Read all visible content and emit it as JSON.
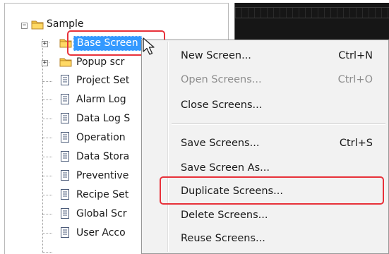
{
  "tree": {
    "root": "Sample",
    "items": [
      {
        "label": "Base Screen",
        "kind": "folder",
        "expandable": true
      },
      {
        "label": "Popup scr",
        "kind": "folder",
        "expandable": true
      },
      {
        "label": "Project Set",
        "kind": "doc"
      },
      {
        "label": "Alarm Log",
        "kind": "doc"
      },
      {
        "label": "Data Log S",
        "kind": "doc"
      },
      {
        "label": "Operation",
        "kind": "doc"
      },
      {
        "label": "Data Stora",
        "kind": "doc"
      },
      {
        "label": "Preventive",
        "kind": "doc"
      },
      {
        "label": "Recipe Set",
        "kind": "doc"
      },
      {
        "label": "Global Scr",
        "kind": "doc"
      },
      {
        "label": "User Acco",
        "kind": "doc"
      }
    ]
  },
  "context_menu": {
    "items": [
      {
        "label": "New Screen...",
        "shortcut": "Ctrl+N",
        "enabled": true
      },
      {
        "label": "Open Screens...",
        "shortcut": "Ctrl+O",
        "enabled": false
      },
      {
        "label": "Close Screens...",
        "shortcut": "",
        "enabled": true
      },
      {
        "label": "Save Screens...",
        "shortcut": "Ctrl+S",
        "enabled": true
      },
      {
        "label": "Save Screen As...",
        "shortcut": "",
        "enabled": true
      },
      {
        "label": "Duplicate Screens...",
        "shortcut": "",
        "enabled": true
      },
      {
        "label": "Delete Screens...",
        "shortcut": "",
        "enabled": true
      },
      {
        "label": "Reuse Screens...",
        "shortcut": "",
        "enabled": true
      }
    ]
  },
  "icons": {
    "folder": "folder-icon",
    "document": "document-icon",
    "expand": "expand-toggle-icon",
    "collapse": "collapse-toggle-icon",
    "cursor": "mouse-cursor-icon"
  },
  "colors": {
    "selection": "#3399ff",
    "highlight_box": "#e8313a",
    "folder": "#f5c542",
    "editor_background": "#161616"
  }
}
